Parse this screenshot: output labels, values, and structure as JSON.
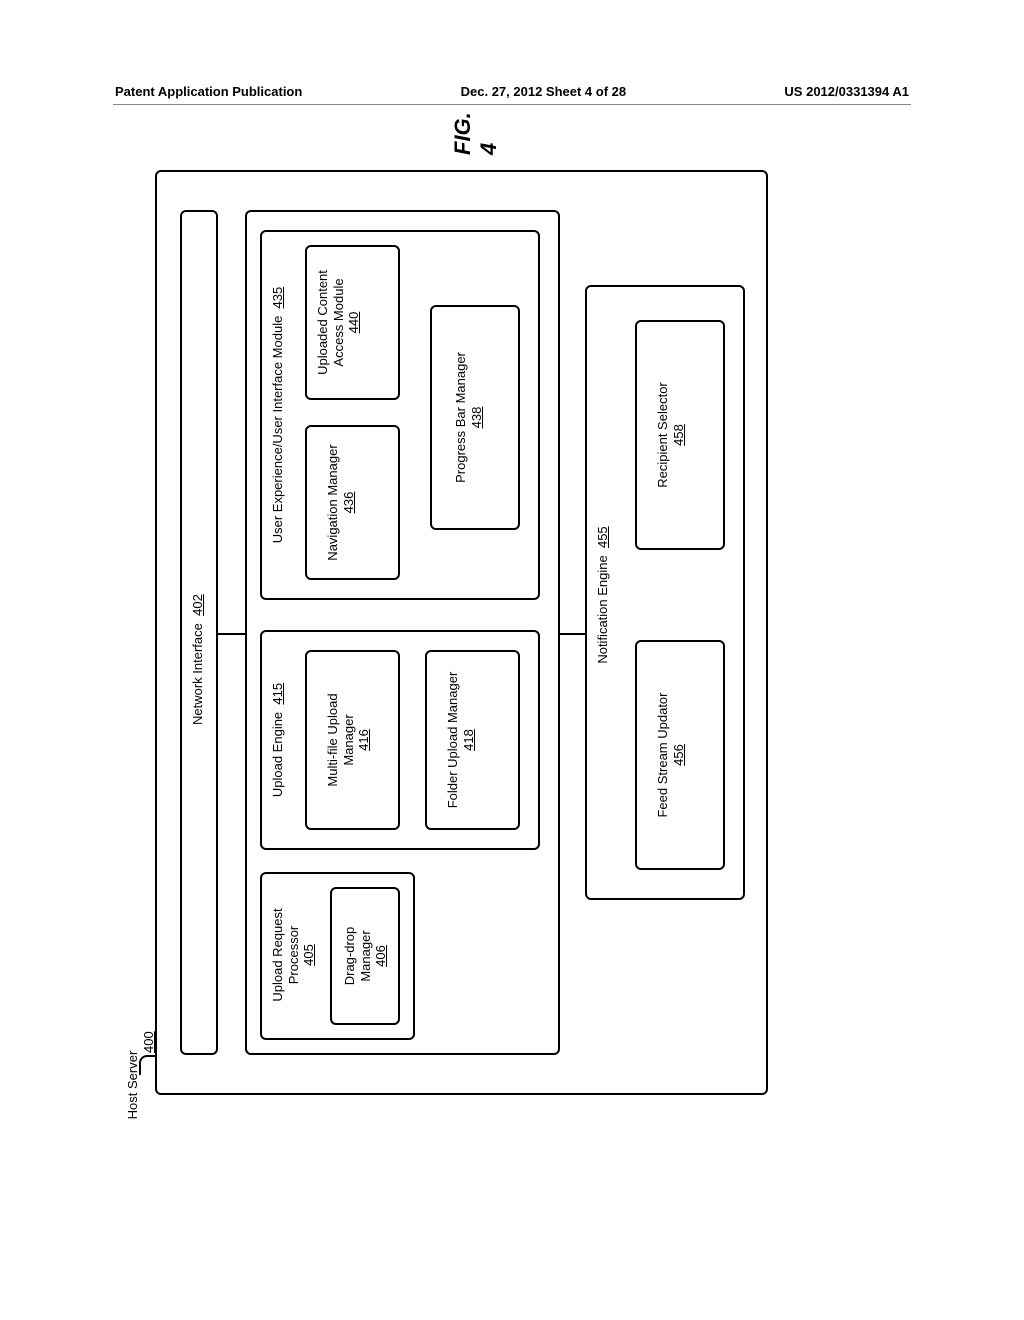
{
  "header": {
    "left": "Patent Application Publication",
    "center": "Dec. 27, 2012  Sheet 4 of 28",
    "right": "US 2012/0331394 A1"
  },
  "diagram": {
    "host_server": "Host Server",
    "host_server_num": "400",
    "network_interface": "Network Interface",
    "network_interface_num": "402",
    "upload_request_processor": "Upload Request Processor",
    "upload_request_processor_num": "405",
    "drag_drop_manager": "Drag-drop Manager",
    "drag_drop_manager_num": "406",
    "upload_engine": "Upload Engine",
    "upload_engine_num": "415",
    "multi_file_upload_manager": "Multi-file Upload Manager",
    "multi_file_upload_manager_num": "416",
    "folder_upload_manager": "Folder Upload Manager",
    "folder_upload_manager_num": "418",
    "ux_module": "User Experience/User Interface Module",
    "ux_module_num": "435",
    "navigation_manager": "Navigation Manager",
    "navigation_manager_num": "436",
    "uploaded_content_access": "Uploaded Content Access Module",
    "uploaded_content_access_num": "440",
    "progress_bar_manager": "Progress Bar Manager",
    "progress_bar_manager_num": "438",
    "notification_engine": "Notification Engine",
    "notification_engine_num": "455",
    "feed_stream_updator": "Feed Stream Updator",
    "feed_stream_updator_num": "456",
    "recipient_selector": "Recipient Selector",
    "recipient_selector_num": "458",
    "fig_label": "FIG. 4"
  }
}
